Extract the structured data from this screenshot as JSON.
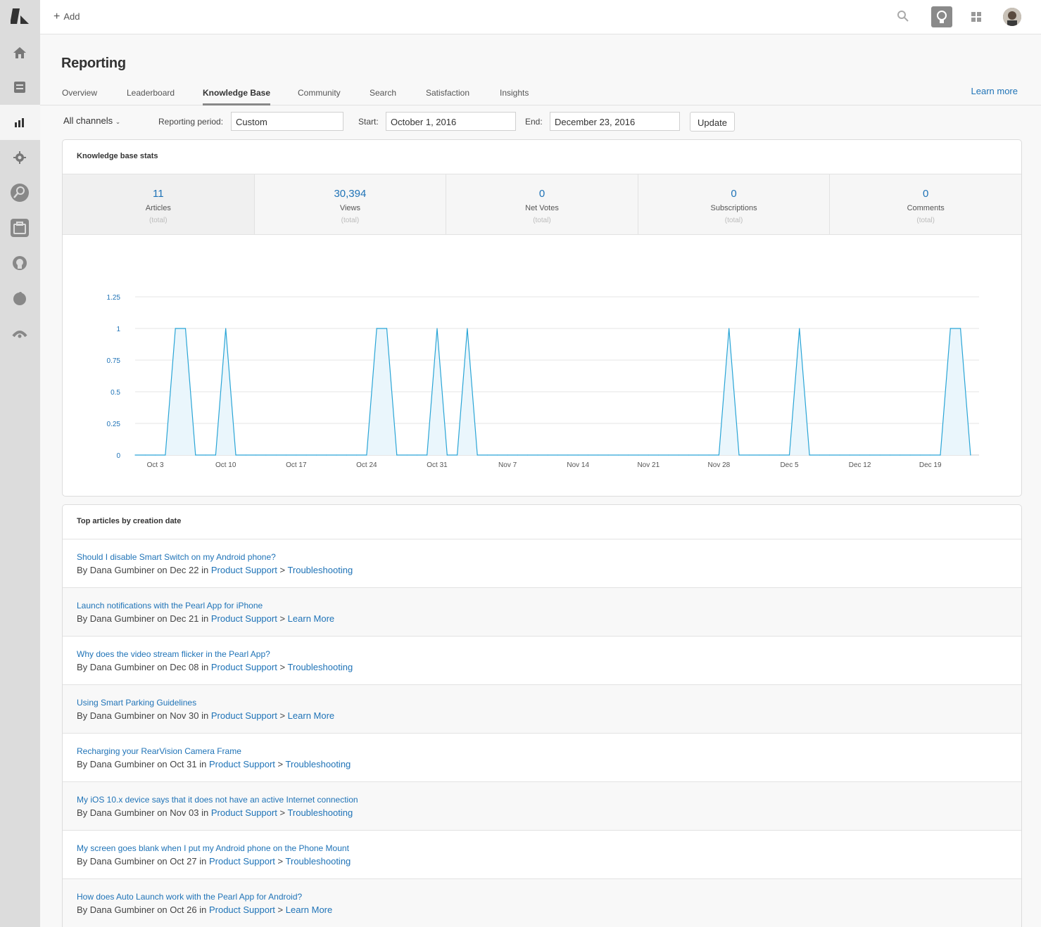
{
  "topbar": {
    "add_label": "Add"
  },
  "page": {
    "title": "Reporting"
  },
  "tabs": [
    {
      "label": "Overview"
    },
    {
      "label": "Leaderboard"
    },
    {
      "label": "Knowledge Base"
    },
    {
      "label": "Community"
    },
    {
      "label": "Search"
    },
    {
      "label": "Satisfaction"
    },
    {
      "label": "Insights"
    }
  ],
  "learn_more": "Learn more",
  "filters": {
    "channels": "All channels",
    "period_label": "Reporting period:",
    "period_value": "Custom",
    "start_label": "Start:",
    "start_value": "October 1, 2016",
    "end_label": "End:",
    "end_value": "December 23, 2016",
    "update_label": "Update"
  },
  "stats_card": {
    "title": "Knowledge base stats",
    "stats": [
      {
        "value": "11",
        "name": "Articles",
        "note": "(total)"
      },
      {
        "value": "30,394",
        "name": "Views",
        "note": "(total)"
      },
      {
        "value": "0",
        "name": "Net Votes",
        "note": "(total)"
      },
      {
        "value": "0",
        "name": "Subscriptions",
        "note": "(total)"
      },
      {
        "value": "0",
        "name": "Comments",
        "note": "(total)"
      }
    ]
  },
  "chart_data": {
    "type": "area",
    "title": "",
    "xlabel": "",
    "ylabel": "",
    "ylim": [
      0,
      1.25
    ],
    "yticks": [
      "0",
      "0.25",
      "0.5",
      "0.75",
      "1",
      "1.25"
    ],
    "xticks": [
      "Oct 3",
      "Oct 10",
      "Oct 17",
      "Oct 24",
      "Oct 31",
      "Nov 7",
      "Nov 14",
      "Nov 21",
      "Nov 28",
      "Dec 5",
      "Dec 12",
      "Dec 19"
    ],
    "grid": true,
    "series": [
      {
        "color": "#2aa5d6",
        "x": [
          "Oct 1",
          "Oct 2",
          "Oct 3",
          "Oct 4",
          "Oct 5",
          "Oct 6",
          "Oct 7",
          "Oct 8",
          "Oct 9",
          "Oct 10",
          "Oct 11",
          "Oct 12",
          "Oct 13",
          "Oct 14",
          "Oct 15",
          "Oct 16",
          "Oct 17",
          "Oct 18",
          "Oct 19",
          "Oct 20",
          "Oct 21",
          "Oct 22",
          "Oct 23",
          "Oct 24",
          "Oct 25",
          "Oct 26",
          "Oct 27",
          "Oct 28",
          "Oct 29",
          "Oct 30",
          "Oct 31",
          "Nov 1",
          "Nov 2",
          "Nov 3",
          "Nov 4",
          "Nov 5",
          "Nov 6",
          "Nov 7",
          "Nov 8",
          "Nov 9",
          "Nov 10",
          "Nov 11",
          "Nov 12",
          "Nov 13",
          "Nov 14",
          "Nov 15",
          "Nov 16",
          "Nov 17",
          "Nov 18",
          "Nov 19",
          "Nov 20",
          "Nov 21",
          "Nov 22",
          "Nov 23",
          "Nov 24",
          "Nov 25",
          "Nov 26",
          "Nov 27",
          "Nov 28",
          "Nov 29",
          "Nov 30",
          "Dec 1",
          "Dec 2",
          "Dec 3",
          "Dec 4",
          "Dec 5",
          "Dec 6",
          "Dec 7",
          "Dec 8",
          "Dec 9",
          "Dec 10",
          "Dec 11",
          "Dec 12",
          "Dec 13",
          "Dec 14",
          "Dec 15",
          "Dec 16",
          "Dec 17",
          "Dec 18",
          "Dec 19",
          "Dec 20",
          "Dec 21",
          "Dec 22",
          "Dec 23"
        ],
        "values": [
          0,
          0,
          0,
          0,
          1,
          1,
          0,
          0,
          0,
          1,
          0,
          0,
          0,
          0,
          0,
          0,
          0,
          0,
          0,
          0,
          0,
          0,
          0,
          0,
          1,
          1,
          0,
          0,
          0,
          0,
          1,
          0,
          0,
          1,
          0,
          0,
          0,
          0,
          0,
          0,
          0,
          0,
          0,
          0,
          0,
          0,
          0,
          0,
          0,
          0,
          0,
          0,
          0,
          0,
          0,
          0,
          0,
          0,
          0,
          1,
          0,
          0,
          0,
          0,
          0,
          0,
          1,
          0,
          0,
          0,
          0,
          0,
          0,
          0,
          0,
          0,
          0,
          0,
          0,
          0,
          0,
          1,
          1,
          0
        ]
      }
    ]
  },
  "articles_card": {
    "title": "Top articles by creation date",
    "by_word": "By",
    "on_word": "on",
    "in_word": "in",
    "separator": ">",
    "items": [
      {
        "title": "Should I disable Smart Switch on my Android phone?",
        "author": "Dana Gumbiner",
        "date": "Dec 22",
        "category": "Product Support",
        "section": "Troubleshooting"
      },
      {
        "title": "Launch notifications with the Pearl App for iPhone",
        "author": "Dana Gumbiner",
        "date": "Dec 21",
        "category": "Product Support",
        "section": "Learn More"
      },
      {
        "title": "Why does the video stream flicker in the Pearl App?",
        "author": "Dana Gumbiner",
        "date": "Dec 08",
        "category": "Product Support",
        "section": "Troubleshooting"
      },
      {
        "title": "Using Smart Parking Guidelines",
        "author": "Dana Gumbiner",
        "date": "Nov 30",
        "category": "Product Support",
        "section": "Learn More"
      },
      {
        "title": "Recharging your RearVision Camera Frame",
        "author": "Dana Gumbiner",
        "date": "Oct 31",
        "category": "Product Support",
        "section": "Troubleshooting"
      },
      {
        "title": "My iOS 10.x device says that it does not have an active Internet connection",
        "author": "Dana Gumbiner",
        "date": "Nov 03",
        "category": "Product Support",
        "section": "Troubleshooting"
      },
      {
        "title": "My screen goes blank when I put my Android phone on the Phone Mount",
        "author": "Dana Gumbiner",
        "date": "Oct 27",
        "category": "Product Support",
        "section": "Troubleshooting"
      },
      {
        "title": "How does Auto Launch work with the Pearl App for Android?",
        "author": "Dana Gumbiner",
        "date": "Oct 26",
        "category": "Product Support",
        "section": "Learn More"
      }
    ]
  }
}
